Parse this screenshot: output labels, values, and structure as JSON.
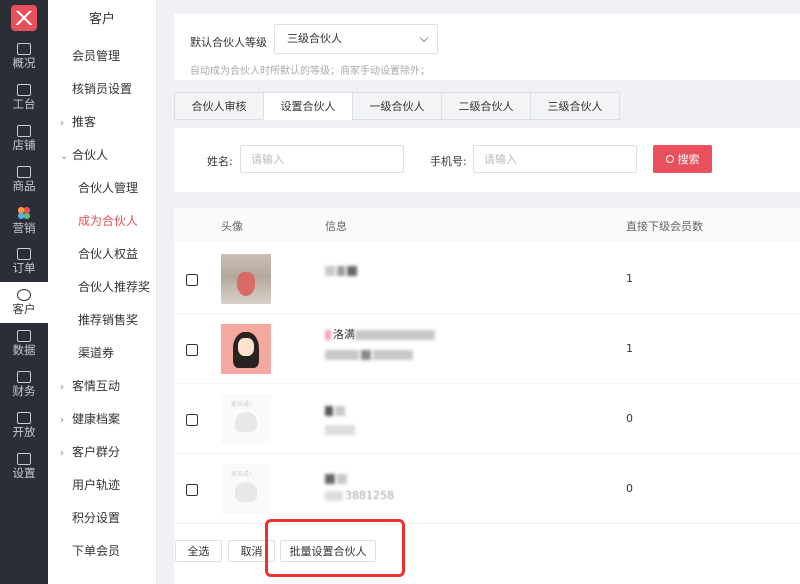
{
  "rail": {
    "items": [
      {
        "label": "概况",
        "icon": "chart-icon"
      },
      {
        "label": "工台",
        "icon": "monitor-icon"
      },
      {
        "label": "店铺",
        "icon": "store-icon"
      },
      {
        "label": "商品",
        "icon": "bag-icon"
      },
      {
        "label": "营销",
        "icon": "marketing-icon"
      },
      {
        "label": "订单",
        "icon": "order-icon"
      },
      {
        "label": "客户",
        "icon": "user-icon"
      },
      {
        "label": "数据",
        "icon": "data-icon"
      },
      {
        "label": "财务",
        "icon": "finance-icon"
      },
      {
        "label": "开放",
        "icon": "code-icon"
      },
      {
        "label": "设置",
        "icon": "gear-icon"
      }
    ],
    "active_index": 6
  },
  "subnav": {
    "title": "客户",
    "items": [
      {
        "label": "会员管理",
        "type": "item"
      },
      {
        "label": "核销员设置",
        "type": "item"
      },
      {
        "label": "推客",
        "type": "group",
        "arrow": "›"
      },
      {
        "label": "合伙人",
        "type": "group",
        "arrow": "⌄"
      },
      {
        "label": "合伙人管理",
        "type": "child"
      },
      {
        "label": "成为合伙人",
        "type": "child"
      },
      {
        "label": "合伙人权益",
        "type": "child"
      },
      {
        "label": "合伙人推荐奖",
        "type": "child"
      },
      {
        "label": "推荐销售奖",
        "type": "child"
      },
      {
        "label": "渠道券",
        "type": "child"
      },
      {
        "label": "客情互动",
        "type": "group",
        "arrow": "›"
      },
      {
        "label": "健康档案",
        "type": "group",
        "arrow": "›"
      },
      {
        "label": "客户群分",
        "type": "group",
        "arrow": "›"
      },
      {
        "label": "用户轨迹",
        "type": "item"
      },
      {
        "label": "积分设置",
        "type": "item"
      },
      {
        "label": "下单会员",
        "type": "item"
      }
    ],
    "active_label": "成为合伙人"
  },
  "level": {
    "label": "默认合伙人等级",
    "value": "三级合伙人",
    "hint": "自动成为合伙人时所默认的等级；商家手动设置除外；"
  },
  "tabs": [
    {
      "label": "合伙人审核",
      "active": false
    },
    {
      "label": "设置合伙人",
      "active": true
    },
    {
      "label": "一级合伙人",
      "active": false
    },
    {
      "label": "二级合伙人",
      "active": false
    },
    {
      "label": "三级合伙人",
      "active": false
    }
  ],
  "search": {
    "name_label": "姓名:",
    "name_placeholder": "请输入",
    "phone_label": "手机号:",
    "phone_placeholder": "请输入",
    "button_label": "搜索"
  },
  "table": {
    "headers": {
      "avatar": "头像",
      "info": "信息",
      "count": "直接下级会员数"
    },
    "rows": [
      {
        "avatar": "photo",
        "line1": "",
        "line2": "",
        "count": "1"
      },
      {
        "avatar": "girl",
        "line1": "洛满",
        "line2": "",
        "count": "1"
      },
      {
        "avatar": "default",
        "avatar_caption": "家长成!",
        "line1": "",
        "line2": "",
        "count": "0"
      },
      {
        "avatar": "default",
        "avatar_caption": "家长成!",
        "line1": "",
        "line2": "3881258",
        "count": "0"
      }
    ]
  },
  "actions": {
    "select_all": "全选",
    "cancel": "取消",
    "batch_set": "批量设置合伙人"
  },
  "colors": {
    "accent": "#e8505b",
    "rail_bg": "#2b2e36",
    "highlight": "#e8322b"
  }
}
